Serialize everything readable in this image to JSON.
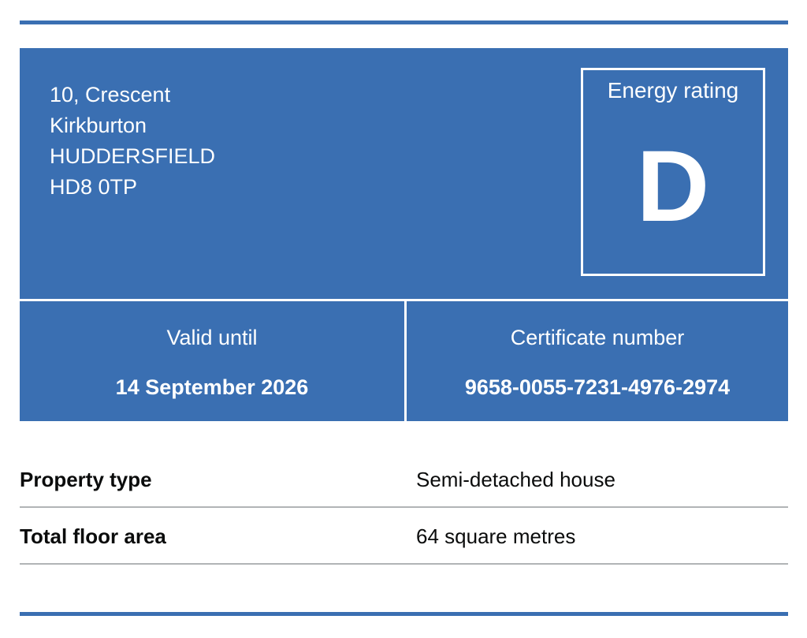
{
  "address": {
    "line1": "10, Crescent",
    "line2": "Kirkburton",
    "line3": "HUDDERSFIELD",
    "line4": "HD8 0TP"
  },
  "rating": {
    "label": "Energy rating",
    "value": "D"
  },
  "valid_until": {
    "label": "Valid until",
    "value": "14 September 2026"
  },
  "certificate": {
    "label": "Certificate number",
    "value": "9658-0055-7231-4976-2974"
  },
  "summary": {
    "rows": [
      {
        "key": "Property type",
        "value": "Semi-detached house"
      },
      {
        "key": "Total floor area",
        "value": "64 square metres"
      }
    ]
  },
  "colors": {
    "panel_blue": "#3a6fb2",
    "text": "#0b0c0c",
    "divider_grey": "#b1b4b6"
  }
}
